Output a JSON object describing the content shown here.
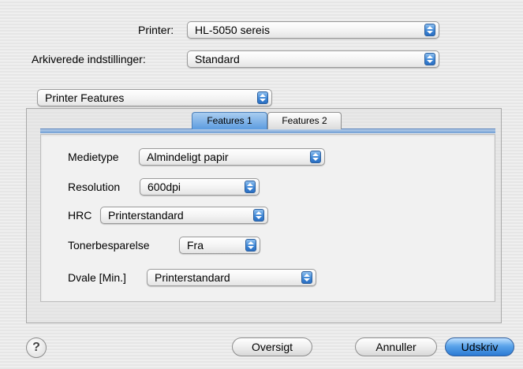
{
  "top": {
    "printer_label": "Printer:",
    "printer_value": "HL-5050 sereis",
    "presets_label": "Arkiverede indstillinger:",
    "presets_value": "Standard",
    "pane_value": "Printer Features"
  },
  "tabs": [
    {
      "label": "Features 1",
      "selected": true
    },
    {
      "label": "Features 2",
      "selected": false
    }
  ],
  "settings": {
    "medietype_label": "Medietype",
    "medietype_value": "Almindeligt papir",
    "resolution_label": "Resolution",
    "resolution_value": "600dpi",
    "hrc_label": "HRC",
    "hrc_value": "Printerstandard",
    "toner_label": "Tonerbesparelse",
    "toner_value": "Fra",
    "dvale_label": "Dvale [Min.]",
    "dvale_value": "Printerstandard"
  },
  "buttons": {
    "help": "?",
    "preview": "Oversigt",
    "cancel": "Annuller",
    "print": "Udskriv"
  },
  "colors": {
    "accent_blue": "#3d86d6",
    "background": "#ececec"
  }
}
